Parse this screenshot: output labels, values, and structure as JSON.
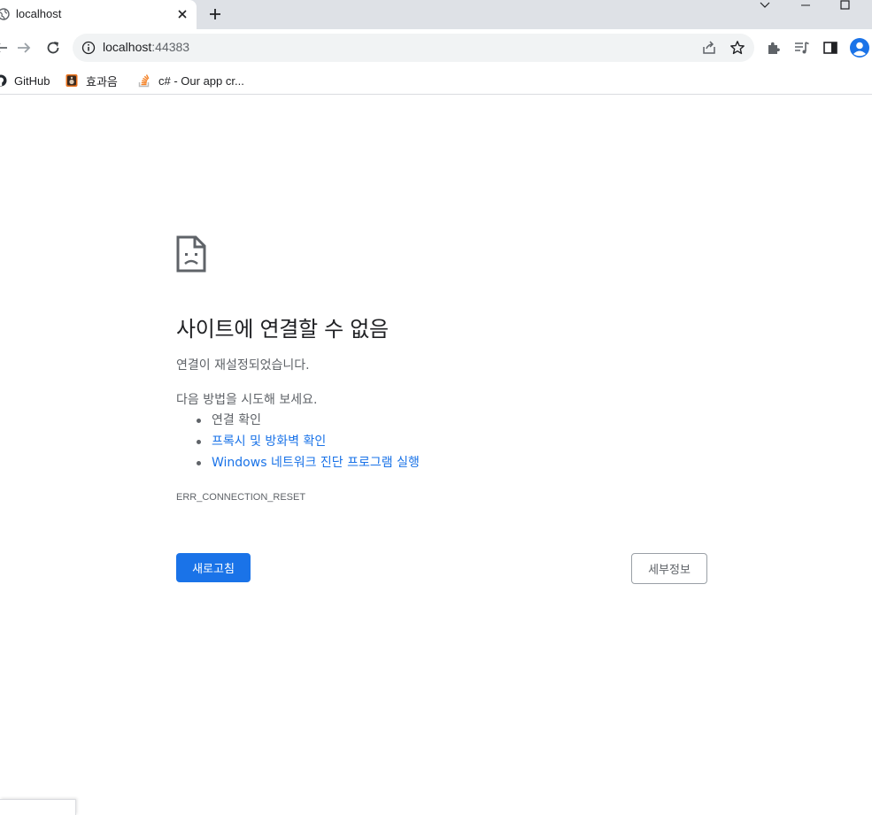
{
  "tab": {
    "title": "localhost"
  },
  "omnibox": {
    "host": "localhost",
    "port": ":44383"
  },
  "bookmarks": [
    {
      "label": "GitHub",
      "icon": "github-icon"
    },
    {
      "label": "효과음",
      "icon": "speaker-icon"
    },
    {
      "label": "c# - Our app cr...",
      "icon": "stackoverflow-icon"
    }
  ],
  "error": {
    "title": "사이트에 연결할 수 없음",
    "description": "연결이 재설정되었습니다.",
    "try_heading": "다음 방법을 시도해 보세요.",
    "suggestions": [
      {
        "label": "연결 확인",
        "link": false
      },
      {
        "label": "프록시 및 방화벽 확인",
        "link": true
      },
      {
        "label": "Windows 네트워크 진단 프로그램 실행",
        "link": true
      }
    ],
    "code": "ERR_CONNECTION_RESET"
  },
  "buttons": {
    "reload": "새로고침",
    "details": "세부정보"
  },
  "colors": {
    "accent": "#1a73e8",
    "text_secondary": "#5f6368",
    "tabstrip": "#dee1e6"
  }
}
